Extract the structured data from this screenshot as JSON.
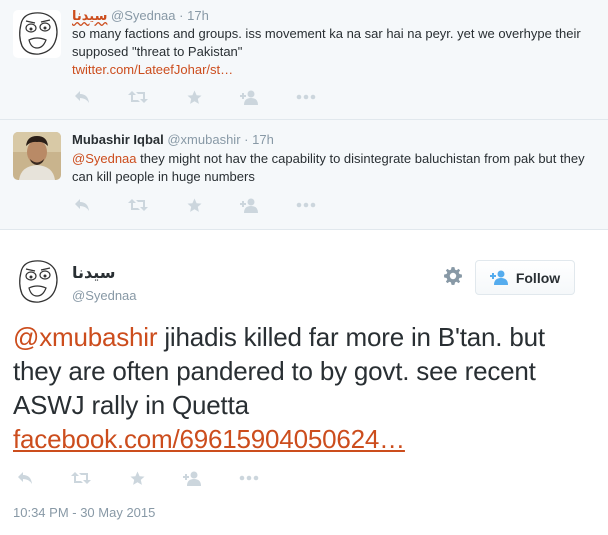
{
  "tweets": [
    {
      "name": "سیدنا",
      "handle": "@Syednaa",
      "sep": "·",
      "time": "17h",
      "text": "so many factions and groups. iss movement ka na sar hai na peyr. yet we overhype their supposed \"threat to Pakistan\"",
      "link": "twitter.com/LateefJohar/st…"
    },
    {
      "name": "Mubashir Iqbal",
      "handle": "@xmubashir",
      "sep": "·",
      "time": "17h",
      "mention": "@Syednaa",
      "text": " they might not hav the capability to disintegrate baluchistan from pak but they can kill people in huge numbers"
    }
  ],
  "main_tweet": {
    "name": "سیدنا",
    "handle": "@Syednaa",
    "follow_label": "Follow",
    "mention": "@xmubashir",
    "text": " jihadis killed far more in B'tan. but they are often pandered to by govt. see recent ASWJ rally in Quetta ",
    "link": "facebook.com/69615904050624…",
    "timestamp": "10:34 PM - 30 May 2015"
  },
  "icons": {
    "reply": "reply-icon",
    "retweet": "retweet-icon",
    "favorite": "star-icon",
    "follow": "follow-person-icon",
    "more": "more-icon",
    "settings": "gear-icon"
  },
  "colors": {
    "link": "#cc4d1d",
    "muted": "#8899a6",
    "action_icon": "#ccd6dd",
    "follow_icon": "#55acee",
    "card_bg": "#f5f8fa"
  }
}
